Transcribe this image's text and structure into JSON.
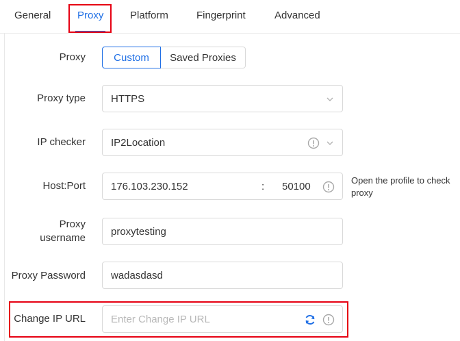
{
  "tabs": [
    {
      "label": "General"
    },
    {
      "label": "Proxy",
      "active": true
    },
    {
      "label": "Platform"
    },
    {
      "label": "Fingerprint"
    },
    {
      "label": "Advanced"
    }
  ],
  "proxy": {
    "label": "Proxy",
    "options": [
      "Custom",
      "Saved Proxies"
    ],
    "selected": "Custom"
  },
  "proxy_type": {
    "label": "Proxy type",
    "value": "HTTPS"
  },
  "ip_checker": {
    "label": "IP checker",
    "value": "IP2Location"
  },
  "host_port": {
    "label": "Host:Port",
    "host": "176.103.230.152",
    "separator": ":",
    "port": "50100",
    "help": "Open the profile to check proxy"
  },
  "username": {
    "label_line1": "Proxy",
    "label_line2": "username",
    "value": "proxytesting"
  },
  "password": {
    "label": "Proxy Password",
    "value": "wadasdasd"
  },
  "change_ip": {
    "label": "Change IP URL",
    "placeholder": "Enter Change IP URL"
  },
  "colors": {
    "accent": "#1f6fe5",
    "highlight": "#e60012",
    "border": "#d9d9d9"
  }
}
